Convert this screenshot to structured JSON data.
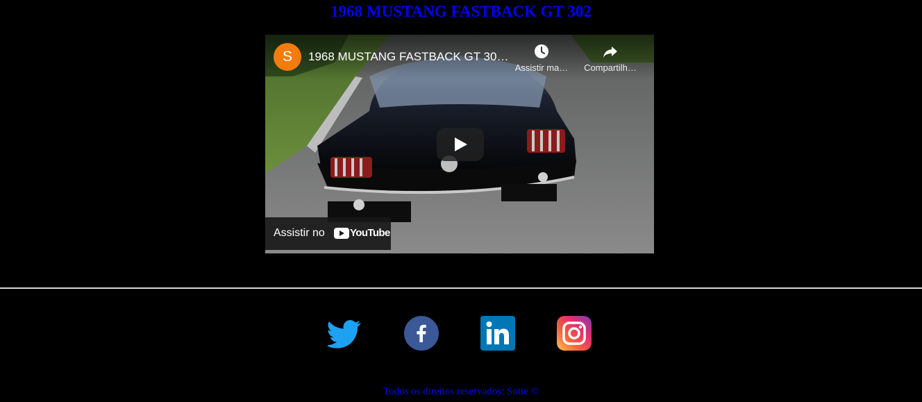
{
  "page": {
    "title": "1968 MUSTANG FASTBACK GT 302"
  },
  "video": {
    "channel_initial": "S",
    "title": "1968 MUSTANG FASTBACK GT 30…",
    "watch_later_label": "Assistir ma…",
    "share_label": "Compartilh…",
    "watch_on_label": "Assistir no",
    "youtube_label": "YouTube",
    "play_icon": "play-icon",
    "avatar_color": "#f47c0c"
  },
  "social": [
    {
      "name": "twitter",
      "icon": "twitter-icon",
      "color": "#1da1f2"
    },
    {
      "name": "facebook",
      "icon": "facebook-icon",
      "color": "#3b5998"
    },
    {
      "name": "linkedin",
      "icon": "linkedin-icon",
      "color": "#0077b5"
    },
    {
      "name": "instagram",
      "icon": "instagram-icon",
      "color": "#e1306c"
    }
  ],
  "footer": {
    "text": "Todos os direitos reservados: Sotie ©"
  }
}
